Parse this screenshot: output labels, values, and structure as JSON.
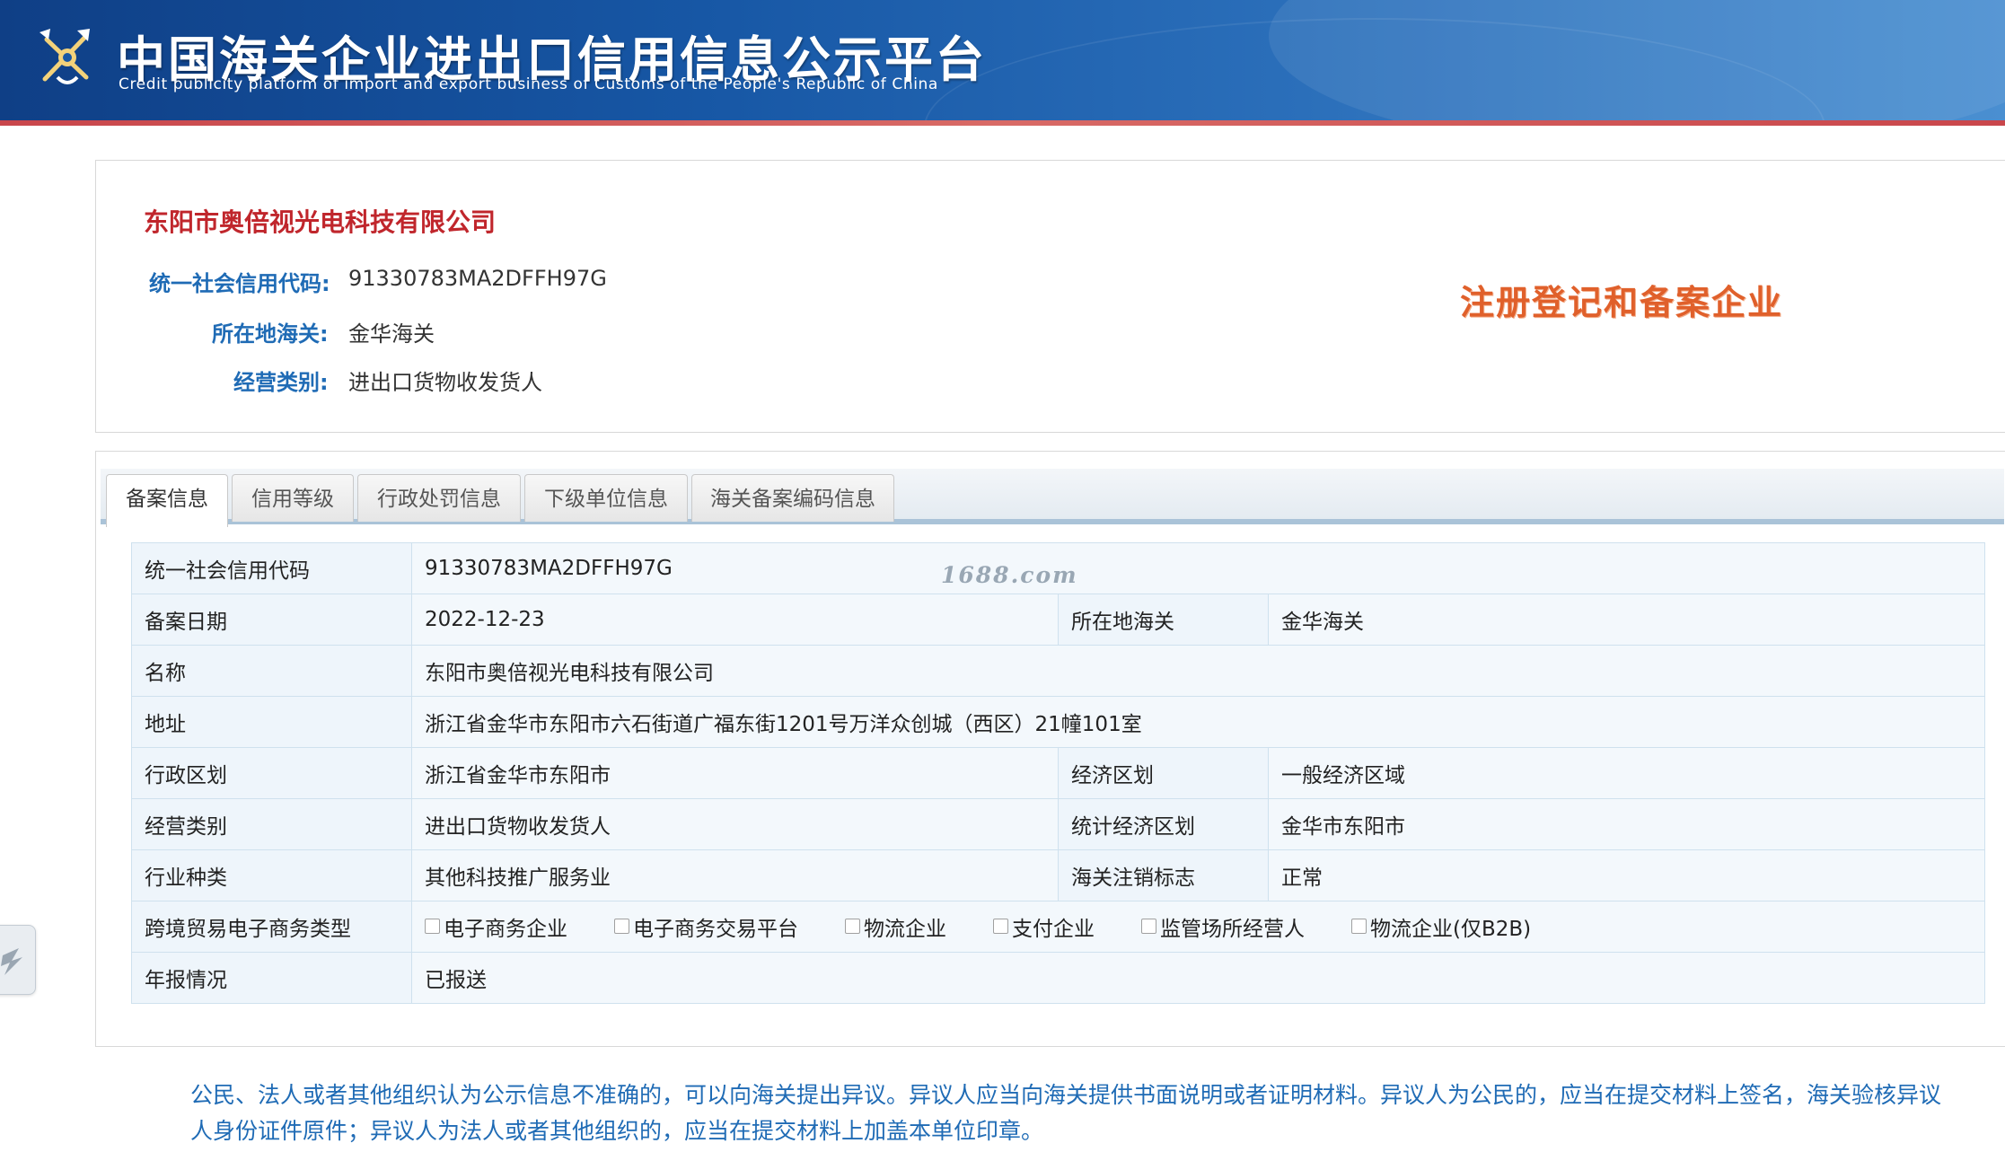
{
  "header": {
    "title": "中国海关企业进出口信用信息公示平台",
    "subtitle": "Credit publicity platform of import and export business of Customs of the People's Republic of China",
    "colors": {
      "banner_dark": "#0f3f86",
      "banner_light": "#4a8fd1",
      "strip": "#c9464b"
    }
  },
  "summary": {
    "company_name": "东阳市奥倍视光电科技有限公司",
    "rows": [
      {
        "label": "统一社会信用代码:",
        "value": "91330783MA2DFFH97G"
      },
      {
        "label": "所在地海关:",
        "value": "金华海关"
      },
      {
        "label": "经营类别:",
        "value": "进出口货物收发货人"
      }
    ],
    "status_stamp": "注册登记和备案企业"
  },
  "tabs": [
    {
      "label": "备案信息",
      "active": true
    },
    {
      "label": "信用等级",
      "active": false
    },
    {
      "label": "行政处罚信息",
      "active": false
    },
    {
      "label": "下级单位信息",
      "active": false
    },
    {
      "label": "海关备案编码信息",
      "active": false
    }
  ],
  "watermark": "1688.com",
  "details": {
    "credit_code": {
      "label": "统一社会信用代码",
      "value": "91330783MA2DFFH97G"
    },
    "filing_date": {
      "label": "备案日期",
      "value": "2022-12-23"
    },
    "customs": {
      "label": "所在地海关",
      "value": "金华海关"
    },
    "name": {
      "label": "名称",
      "value": "东阳市奥倍视光电科技有限公司"
    },
    "address": {
      "label": "地址",
      "value": "浙江省金华市东阳市六石街道广福东街1201号万洋众创城（西区）21幢101室"
    },
    "admin_region": {
      "label": "行政区划",
      "value": "浙江省金华市东阳市"
    },
    "economic_zone": {
      "label": "经济区划",
      "value": "一般经济区域"
    },
    "business_type": {
      "label": "经营类别",
      "value": "进出口货物收发货人"
    },
    "stat_region": {
      "label": "统计经济区划",
      "value": "金华市东阳市"
    },
    "industry": {
      "label": "行业种类",
      "value": "其他科技推广服务业"
    },
    "deregistration": {
      "label": "海关注销标志",
      "value": "正常"
    },
    "ecommerce": {
      "label": "跨境贸易电子商务类型",
      "options": [
        "电子商务企业",
        "电子商务交易平台",
        "物流企业",
        "支付企业",
        "监管场所经营人",
        "物流企业(仅B2B)"
      ]
    },
    "annual_report": {
      "label": "年报情况",
      "value": "已报送"
    }
  },
  "notice": {
    "text": "公民、法人或者其他组织认为公示信息不准确的，可以向海关提出异议。异议人应当向海关提供书面说明或者证明材料。异议人为公民的，应当在提交材料上签名，海关验核异议人身份证件原件；异议人为法人或者其他组织的，应当在提交材料上加盖本单位印章。"
  }
}
